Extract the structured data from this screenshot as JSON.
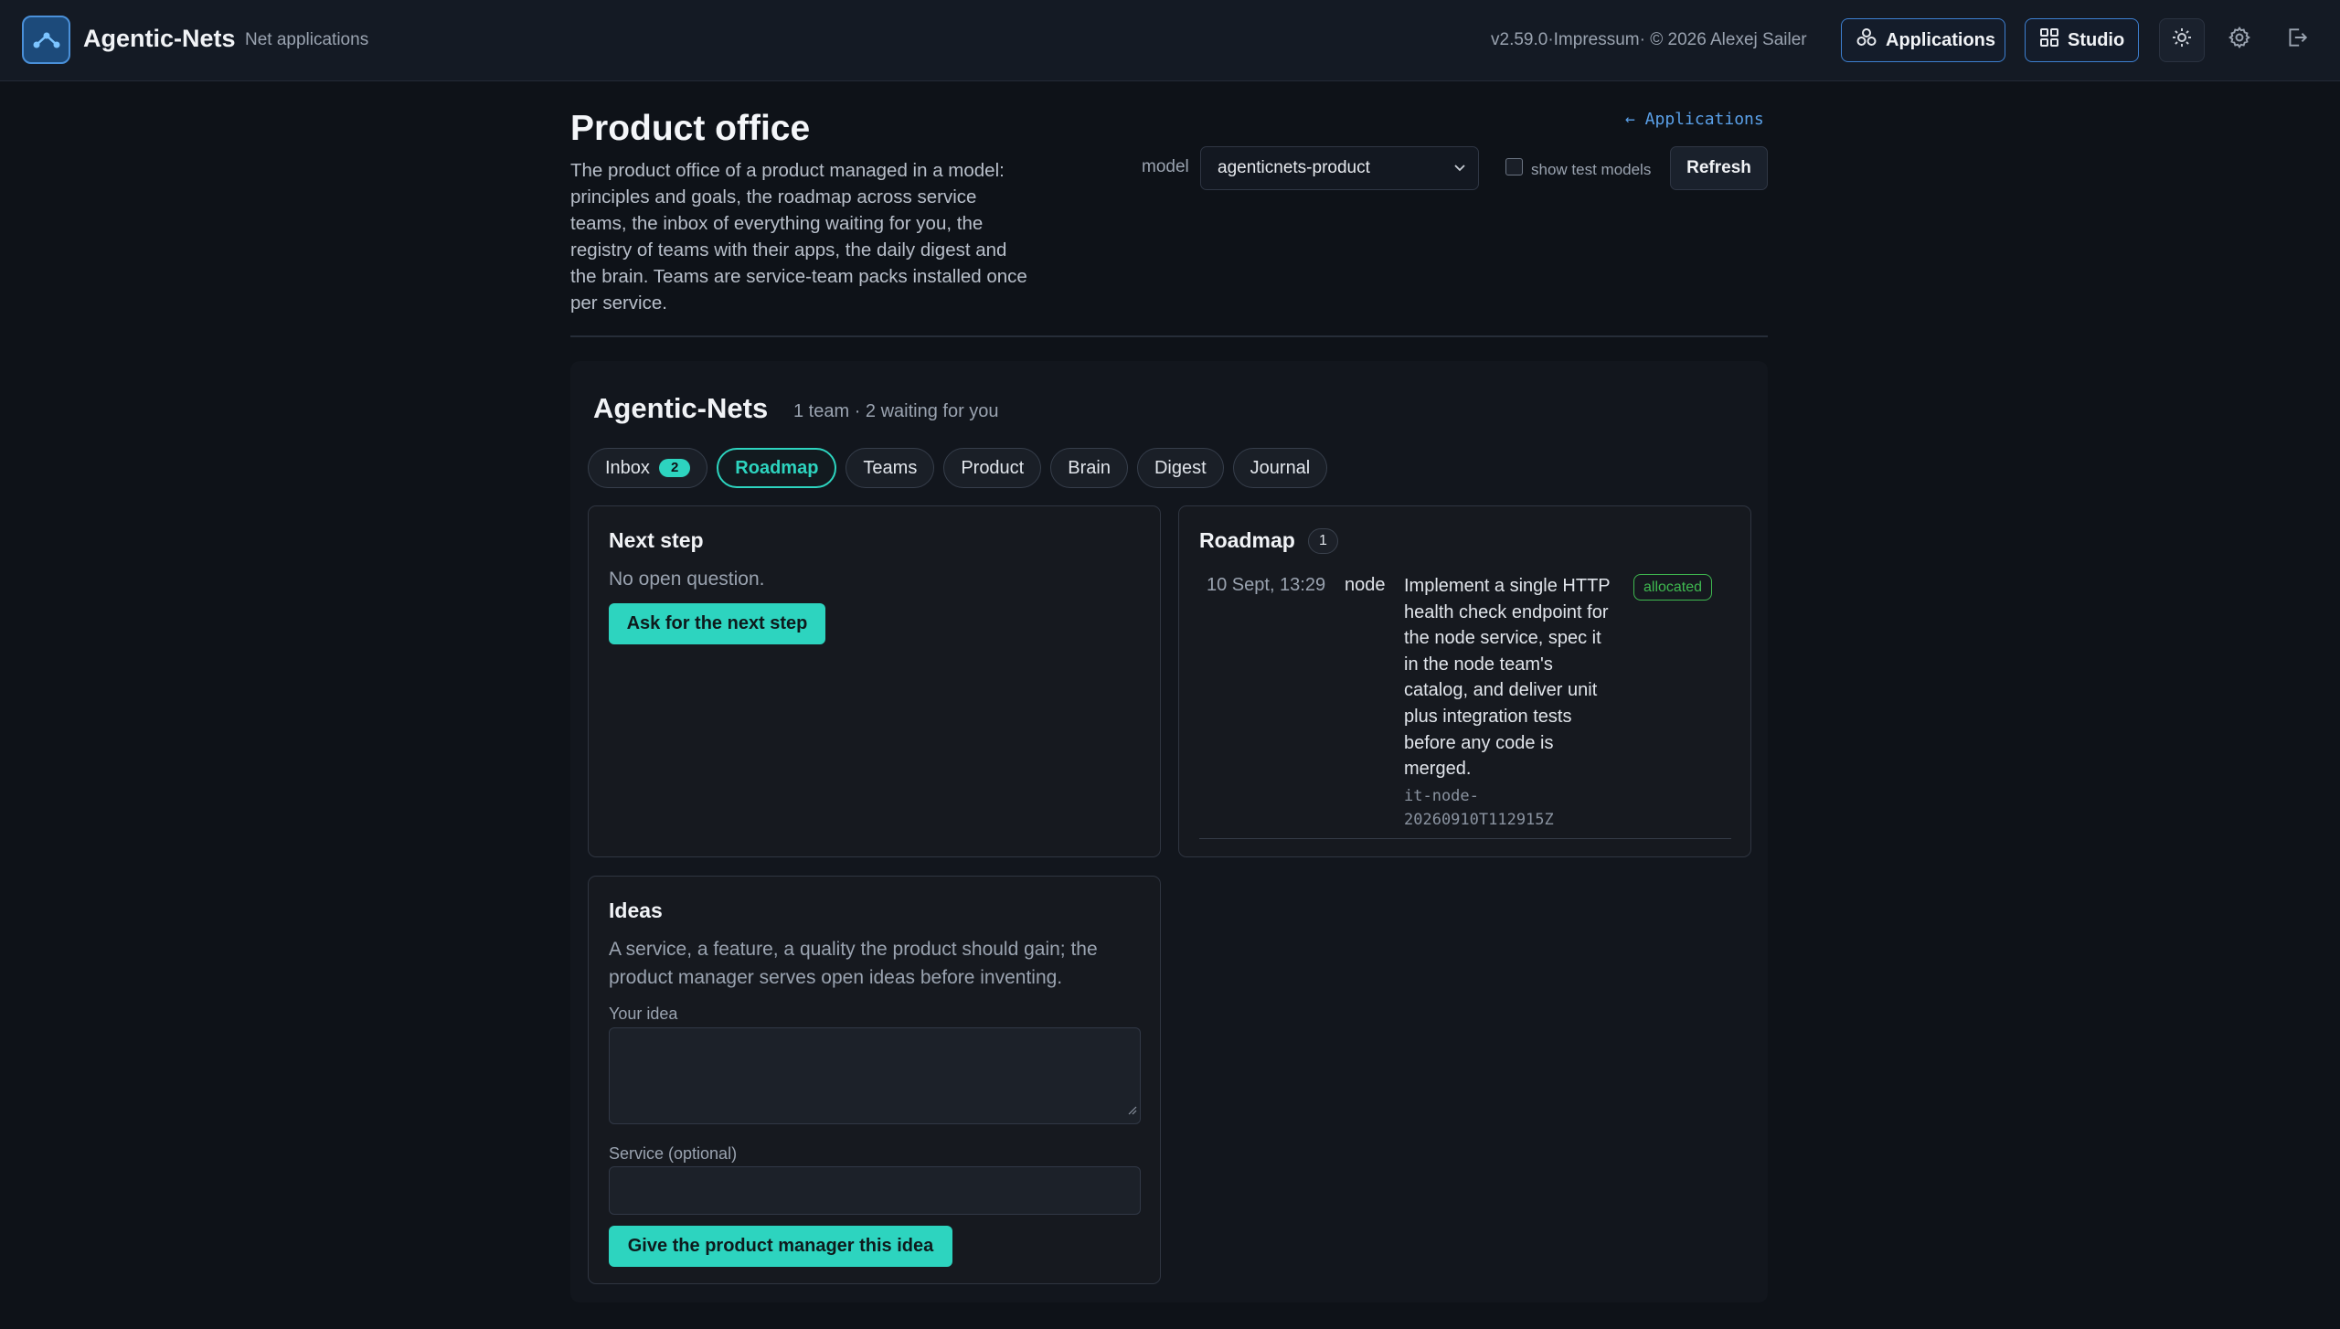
{
  "topbar": {
    "brand": "Agentic-Nets",
    "subtitle": "Net applications",
    "version": "v2.59.0·Impressum· © 2026 Alexej Sailer",
    "applications_label": "Applications",
    "studio_label": "Studio",
    "icons": [
      "logo-icon",
      "applications-icon",
      "studio-grid-icon",
      "sun-icon",
      "gear-icon",
      "logout-icon"
    ]
  },
  "header": {
    "title": "Product office",
    "description": "The product office of a product managed in a model: principles and goals, the roadmap across service teams, the inbox of everything waiting for you, the registry of teams with their apps, the daily digest and the brain. Teams are service-team packs installed once per service.",
    "back_link": "← Applications",
    "model_label": "model",
    "model_value": "agenticnets-product",
    "show_test_label": "show test models",
    "show_test_checked": false,
    "refresh_label": "Refresh"
  },
  "team": {
    "name": "Agentic-Nets",
    "meta": "1 team · 2 waiting for you",
    "tabs": [
      {
        "label": "Inbox",
        "badge": "2"
      },
      {
        "label": "Roadmap",
        "active": true
      },
      {
        "label": "Teams"
      },
      {
        "label": "Product"
      },
      {
        "label": "Brain"
      },
      {
        "label": "Digest"
      },
      {
        "label": "Journal"
      }
    ]
  },
  "next_step": {
    "title": "Next step",
    "status": "No open question.",
    "button": "Ask for the next step"
  },
  "roadmap": {
    "title": "Roadmap",
    "count": "1",
    "items": [
      {
        "date": "10 Sept, 13:29",
        "service": "node",
        "text": "Implement a single HTTP health check endpoint for the node service, spec it in the node team's catalog, and deliver unit plus integration tests before any code is merged.",
        "id": "it-node-20260910T112915Z",
        "status": "allocated"
      }
    ]
  },
  "ideas": {
    "title": "Ideas",
    "description": "A service, a feature, a quality the product should gain; the product manager serves open ideas before inventing.",
    "idea_label": "Your idea",
    "idea_value": "",
    "service_label": "Service (optional)",
    "service_value": "",
    "button": "Give the product manager this idea"
  },
  "colors": {
    "accent": "#2dd4bf",
    "link": "#5aa0e8",
    "status_allocated": "#3fb950",
    "background": "#0e1218"
  }
}
